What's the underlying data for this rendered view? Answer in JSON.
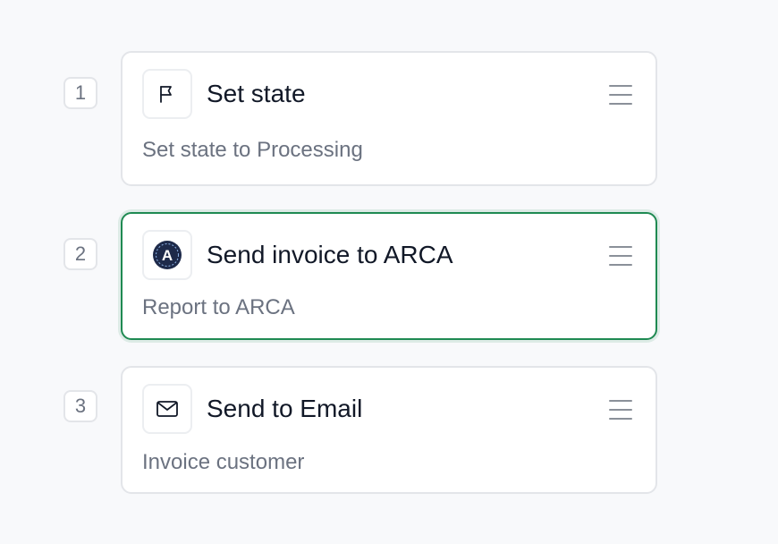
{
  "steps": [
    {
      "number": "1",
      "title": "Set state",
      "subtitle": "Set state to Processing",
      "icon": "flag-icon",
      "active": false
    },
    {
      "number": "2",
      "title": "Send invoice to ARCA",
      "subtitle": "Report to ARCA",
      "icon": "arca-logo-icon",
      "icon_letter": "A",
      "active": true
    },
    {
      "number": "3",
      "title": "Send to Email",
      "subtitle": "Invoice customer",
      "icon": "mail-icon",
      "active": false
    }
  ],
  "colors": {
    "active_border": "#1f8a52",
    "card_border": "#e3e5e9",
    "background": "#f8f9fb",
    "title_text": "#111827",
    "muted_text": "#6b7280",
    "arca_badge": "#1e2a4a"
  }
}
